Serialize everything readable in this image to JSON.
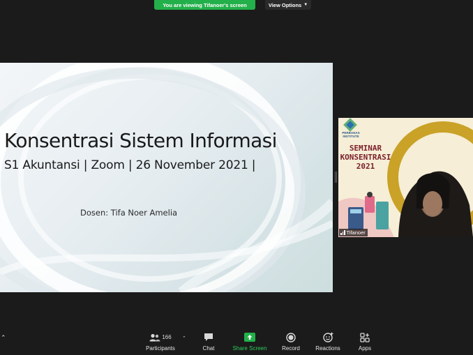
{
  "banner": {
    "text": "You are viewing Tifanoer's screen"
  },
  "view_options": {
    "label": "View Options",
    "chevron_icon": "chevron-down-icon"
  },
  "slide": {
    "title": "Konsentrasi Sistem Informasi",
    "subtitle": "S1 Akuntansi | Zoom | 26 November 2021 |",
    "dosen": "Dosen: Tifa Noer Amelia"
  },
  "participant_video": {
    "name": "Tifanoer",
    "logo_text": "PERBANAS INSTITUTE",
    "poster_line1": "SEMINAR",
    "poster_line2": "KONSENTRASI",
    "poster_line3": "2021"
  },
  "toolbar": {
    "participants": {
      "label": "Participants",
      "count": "166",
      "icon": "participants-icon"
    },
    "chat": {
      "label": "Chat",
      "icon": "chat-icon"
    },
    "share_screen": {
      "label": "Share Screen",
      "icon": "share-screen-icon"
    },
    "record": {
      "label": "Record",
      "icon": "record-icon"
    },
    "reactions": {
      "label": "Reactions",
      "icon": "reactions-icon"
    },
    "apps": {
      "label": "Apps",
      "icon": "apps-icon"
    }
  },
  "colors": {
    "banner_green": "#23b04a",
    "share_green": "#2dcf5c",
    "background": "#1b1b1b",
    "poster_gold": "#c9a227"
  }
}
